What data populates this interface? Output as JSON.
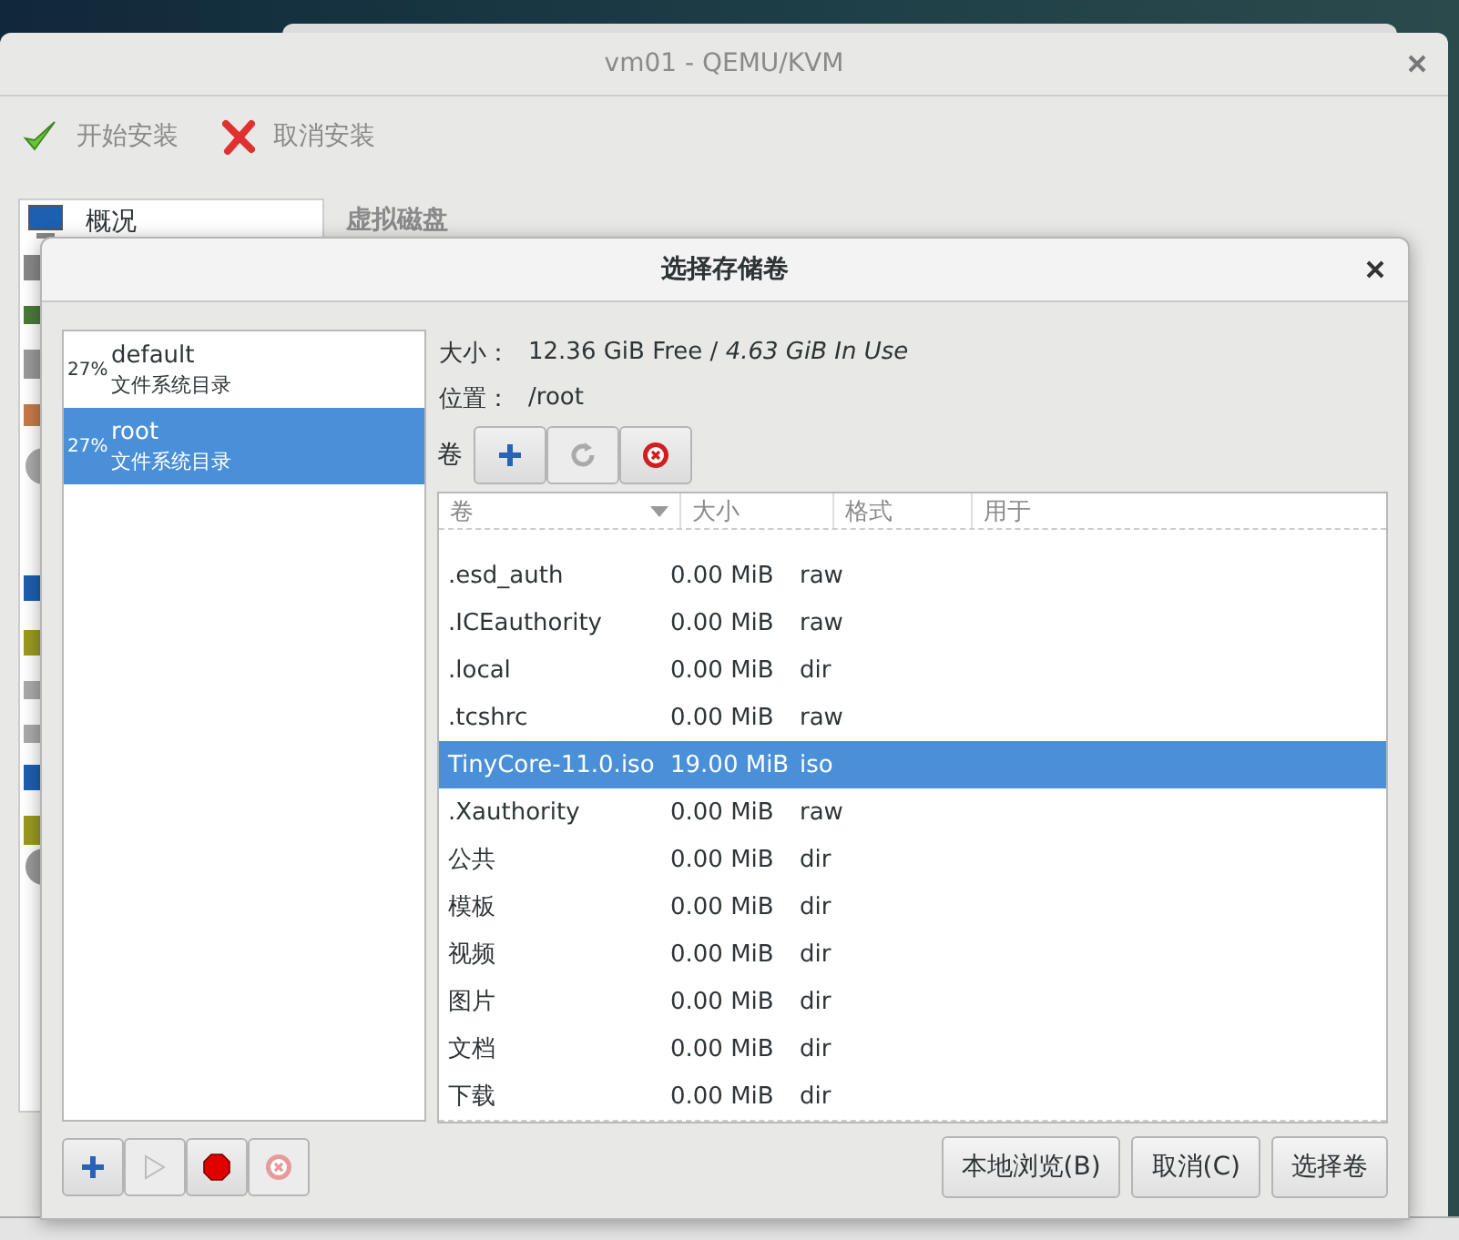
{
  "window": {
    "title": "vm01 - QEMU/KVM"
  },
  "toolbar": [
    {
      "kind": "confirm",
      "label": "开始安装"
    },
    {
      "kind": "cancel",
      "label": "取消安装"
    }
  ],
  "sidebar": {
    "items": [
      {
        "label": "概况"
      }
    ]
  },
  "section_title": "虚拟磁盘",
  "dialog": {
    "title": "选择存储卷",
    "pools": [
      {
        "usage": "27%",
        "name": "default",
        "type": "文件系统目录",
        "selected": false
      },
      {
        "usage": "27%",
        "name": "root",
        "type": "文件系统目录",
        "selected": true
      }
    ],
    "size_label": "大小：",
    "size_value": "12.36 GiB Free / *4.63 GiB In Use*",
    "location_label": "位置：",
    "location": "/root",
    "volumes_label": "卷",
    "volume_buttons": [
      {
        "kind": "add",
        "disabled": false
      },
      {
        "kind": "refresh",
        "disabled": true
      },
      {
        "kind": "delete",
        "disabled": false
      }
    ],
    "columns": [
      "卷",
      "大小",
      "格式",
      "用于"
    ],
    "rows": [
      {
        "name": ".esd_auth",
        "size": "0.00 MiB",
        "format": "raw",
        "selected": false
      },
      {
        "name": ".ICEauthority",
        "size": "0.00 MiB",
        "format": "raw",
        "selected": false
      },
      {
        "name": ".local",
        "size": "0.00 MiB",
        "format": "dir",
        "selected": false
      },
      {
        "name": ".tcshrc",
        "size": "0.00 MiB",
        "format": "raw",
        "selected": false
      },
      {
        "name": "TinyCore-11.0.iso",
        "size": "19.00 MiB",
        "format": "iso",
        "selected": true
      },
      {
        "name": ".Xauthority",
        "size": "0.00 MiB",
        "format": "raw",
        "selected": false
      },
      {
        "name": "公共",
        "size": "0.00 MiB",
        "format": "dir",
        "selected": false
      },
      {
        "name": "模板",
        "size": "0.00 MiB",
        "format": "dir",
        "selected": false
      },
      {
        "name": "视频",
        "size": "0.00 MiB",
        "format": "dir",
        "selected": false
      },
      {
        "name": "图片",
        "size": "0.00 MiB",
        "format": "dir",
        "selected": false
      },
      {
        "name": "文档",
        "size": "0.00 MiB",
        "format": "dir",
        "selected": false
      },
      {
        "name": "下载",
        "size": "0.00 MiB",
        "format": "dir",
        "selected": false
      }
    ],
    "pool_buttons": [
      {
        "kind": "add",
        "disabled": false
      },
      {
        "kind": "start",
        "disabled": true
      },
      {
        "kind": "stop",
        "disabled": false
      },
      {
        "kind": "delete",
        "disabled": true
      }
    ],
    "actions": [
      "本地浏览(B)",
      "取消(C)",
      "选择卷"
    ]
  }
}
